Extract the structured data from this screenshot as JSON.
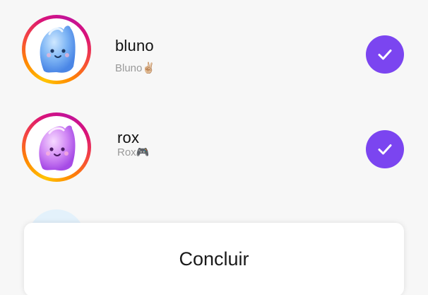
{
  "contacts": [
    {
      "name": "bluno",
      "subtitle": "Bluno✌🏼",
      "selected": true,
      "avatar": "blue-ghost-avatar"
    },
    {
      "name": "rox",
      "subtitle": "Rox🎮",
      "selected": true,
      "avatar": "purple-ghost-avatar"
    }
  ],
  "colors": {
    "accent": "#7b45f0",
    "ring_gradient": [
      "#ffc400",
      "#ff8a00",
      "#f5483e",
      "#d9127a",
      "#c1139a"
    ]
  },
  "icons": {
    "check": "check-icon"
  },
  "footer": {
    "done_label": "Concluir"
  }
}
